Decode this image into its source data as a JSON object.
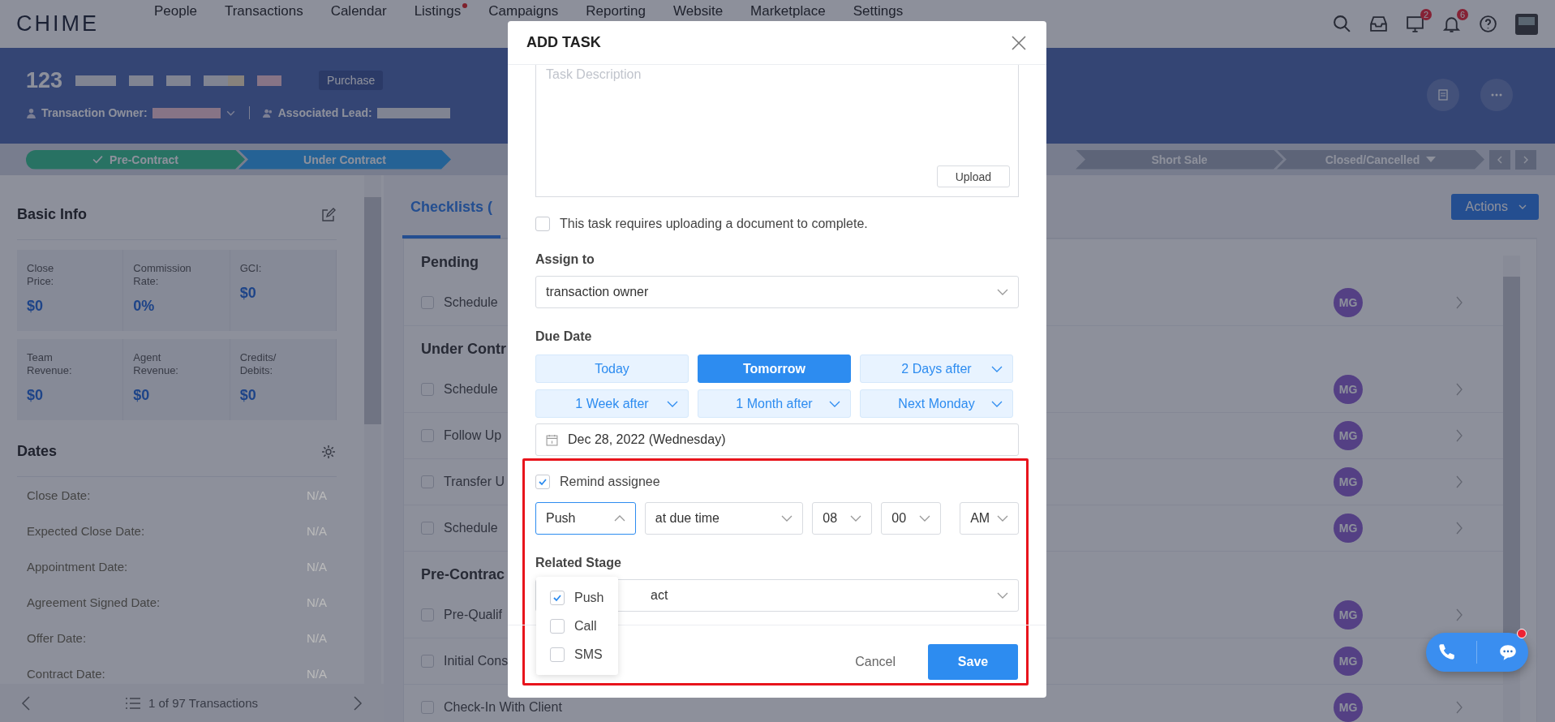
{
  "nav": {
    "logo": "CHIME",
    "items": [
      {
        "label": "People",
        "dot": false
      },
      {
        "label": "Transactions",
        "dot": false
      },
      {
        "label": "Calendar",
        "dot": false
      },
      {
        "label": "Listings",
        "dot": true
      },
      {
        "label": "Campaigns",
        "dot": false
      },
      {
        "label": "Reporting",
        "dot": false
      },
      {
        "label": "Website",
        "dot": false
      },
      {
        "label": "Marketplace",
        "dot": false
      },
      {
        "label": "Settings",
        "dot": false
      }
    ],
    "tools": [
      {
        "kind": "search"
      },
      {
        "kind": "inbox"
      },
      {
        "kind": "monitor",
        "badge": "2"
      },
      {
        "kind": "bell",
        "badge": "6"
      },
      {
        "kind": "help"
      },
      {
        "kind": "avatar"
      }
    ]
  },
  "header": {
    "number": "123",
    "tag": "Purchase",
    "owner_label": "Transaction Owner:",
    "lead_label": "Associated Lead:"
  },
  "stages": [
    {
      "label": "Pre-Contract",
      "kind": "done"
    },
    {
      "label": "Under Contract",
      "kind": "current"
    },
    {
      "label": "Short Sale",
      "kind": "upcoming"
    },
    {
      "label": "Closed/Cancelled",
      "kind": "menu"
    }
  ],
  "basic_info": {
    "title": "Basic Info",
    "cards": [
      {
        "label": "Close\nPrice:",
        "value": "$0"
      },
      {
        "label": "Commission\nRate:",
        "value": "0%"
      },
      {
        "label": "GCI:",
        "value": "$0"
      },
      {
        "label": "Team\nRevenue:",
        "value": "$0"
      },
      {
        "label": "Agent\nRevenue:",
        "value": "$0"
      },
      {
        "label": "Credits/\nDebits:",
        "value": "$0"
      }
    ]
  },
  "dates": {
    "title": "Dates",
    "rows": [
      {
        "label": "Close Date:",
        "value": "N/A"
      },
      {
        "label": "Expected Close Date:",
        "value": "N/A"
      },
      {
        "label": "Appointment Date:",
        "value": "N/A"
      },
      {
        "label": "Agreement Signed Date:",
        "value": "N/A"
      },
      {
        "label": "Offer Date:",
        "value": "N/A"
      },
      {
        "label": "Contract Date:",
        "value": "N/A"
      }
    ]
  },
  "pager": {
    "text": "1 of 97 Transactions"
  },
  "checklists": {
    "tab": "Checklists (",
    "actions": "Actions",
    "groups": [
      {
        "title": "Pending",
        "items": [
          {
            "text": "Schedule",
            "checked": false,
            "assignee": "MG"
          }
        ]
      },
      {
        "title": "Under Contr",
        "items": [
          {
            "text": "Schedule",
            "checked": false,
            "assignee": "MG"
          },
          {
            "text": "Follow Up",
            "checked": false,
            "assignee": "MG"
          },
          {
            "text": "Transfer U",
            "checked": false,
            "assignee": "MG"
          },
          {
            "text": "Schedule",
            "checked": false,
            "assignee": "MG"
          }
        ]
      },
      {
        "title": "Pre-Contrac",
        "items": [
          {
            "text": "Pre-Qualif",
            "checked": false,
            "assignee": "MG"
          },
          {
            "text": "Initial Cons",
            "checked": false,
            "assignee": "MG"
          },
          {
            "text": "Check-In With Client",
            "checked": false,
            "assignee": "MG"
          }
        ]
      }
    ]
  },
  "modal": {
    "title": "ADD TASK",
    "description": {
      "placeholder": "Task Description"
    },
    "upload": "Upload",
    "require_doc": {
      "label": "This task requires uploading a document to complete.",
      "checked": false
    },
    "assign": {
      "label": "Assign to",
      "value": "transaction owner"
    },
    "due": {
      "label": "Due Date",
      "options": [
        {
          "label": "Today",
          "kind": "button",
          "selected": false
        },
        {
          "label": "Tomorrow",
          "kind": "button",
          "selected": true
        },
        {
          "label": "2 Days after",
          "kind": "dropdown",
          "selected": false
        },
        {
          "label": "1 Week after",
          "kind": "dropdown",
          "selected": false
        },
        {
          "label": "1 Month after",
          "kind": "dropdown",
          "selected": false
        },
        {
          "label": "Next Monday",
          "kind": "dropdown",
          "selected": false
        }
      ],
      "date": "Dec 28, 2022 (Wednesday)"
    },
    "remind": {
      "label": "Remind assignee",
      "checked": true,
      "channel": {
        "value": "Push",
        "open": true
      },
      "when": "at due time",
      "hour": "08",
      "minute": "00",
      "ampm": "AM"
    },
    "stage": {
      "label": "Related Stage",
      "value": "act"
    },
    "channel_menu": [
      {
        "label": "Push",
        "checked": true
      },
      {
        "label": "Call",
        "checked": false
      },
      {
        "label": "SMS",
        "checked": false
      }
    ],
    "cancel": "Cancel",
    "save": "Save"
  }
}
